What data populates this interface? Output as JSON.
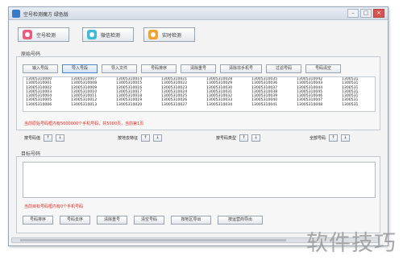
{
  "window": {
    "title": "空号检测魔方 绿色版",
    "min": "–",
    "max": "□",
    "close": "×"
  },
  "top_buttons": [
    {
      "label": "空号检测"
    },
    {
      "label": "微信检测"
    },
    {
      "label": "实时检测"
    }
  ],
  "source_section": {
    "label": "原始号码",
    "buttons": [
      "输入号段",
      "导入号段",
      "导入文件",
      "号码排序",
      "清除重号",
      "清除非手机号",
      "过滤号码",
      "号码清空"
    ],
    "selected_button": "导入号段",
    "columns": [
      [
        "13005310000",
        "13005310001",
        "13005310002",
        "13005310003",
        "13005310004",
        "13005310005",
        "13005310006"
      ],
      [
        "13005310007",
        "13005310008",
        "13005310009",
        "13005310010",
        "13005310011",
        "13005310012",
        "13005310013"
      ],
      [
        "13005310014",
        "13005310015",
        "13005310016",
        "13005310017",
        "13005310018",
        "13005310019",
        "13005310020"
      ],
      [
        "13005310021",
        "13005310022",
        "13005310023",
        "13005310024",
        "13005310025",
        "13005310026",
        "13005310027"
      ],
      [
        "13005310028",
        "13005310029",
        "13005310030",
        "13005310031",
        "13005310032",
        "13005310033",
        "13005310034"
      ],
      [
        "13005310035",
        "13005310036",
        "13005310037",
        "13005310038",
        "13005310039",
        "13005310040",
        "13005310041"
      ],
      [
        "13005310042",
        "13005310043",
        "13005310044",
        "13005310045",
        "13005310046",
        "13005310047",
        "13005310048"
      ],
      [
        "1300531",
        "1300531",
        "1300531",
        "1300531",
        "1300531",
        "1300531",
        "1300531"
      ]
    ],
    "status": "当前原始号码框内有5000000个手机号码，共5000页，当前第1页"
  },
  "filters": [
    {
      "label": "按号码值"
    },
    {
      "label": "按地去特征"
    },
    {
      "label": "按号码类型"
    },
    {
      "label": "全部号码"
    }
  ],
  "arrows": {
    "up": "↑",
    "down": "↓"
  },
  "target_section": {
    "label": "目标号码",
    "status": "当前目标号码框内有0个手机号码",
    "buttons": [
      "号码排序",
      "号码去序",
      "清除重号",
      "清空号码",
      "按地区导出",
      "按运营商导出"
    ]
  },
  "watermark": "软件技巧"
}
